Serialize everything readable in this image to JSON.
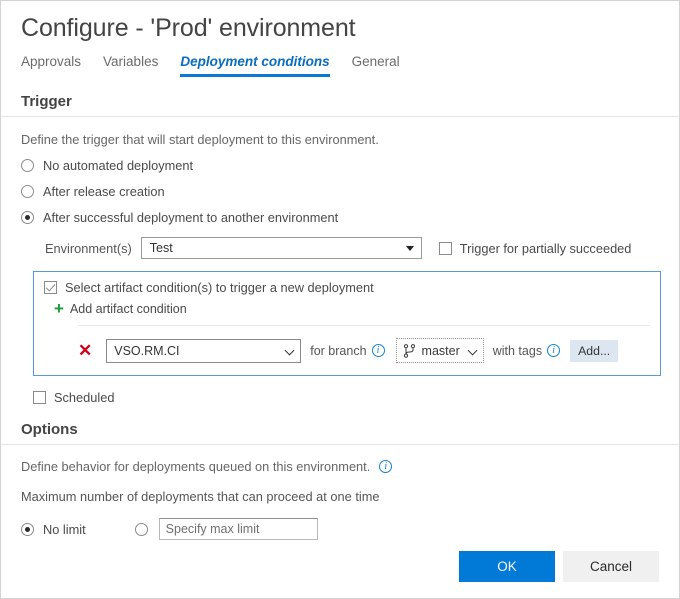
{
  "window": {
    "title": "Configure - 'Prod' environment"
  },
  "tabs": [
    {
      "label": "Approvals",
      "active": false
    },
    {
      "label": "Variables",
      "active": false
    },
    {
      "label": "Deployment conditions",
      "active": true
    },
    {
      "label": "General",
      "active": false
    }
  ],
  "trigger": {
    "heading": "Trigger",
    "description": "Define the trigger that will start deployment to this environment.",
    "options": [
      {
        "label": "No automated deployment",
        "selected": false
      },
      {
        "label": "After release creation",
        "selected": false
      },
      {
        "label": "After successful deployment to another environment",
        "selected": true
      }
    ],
    "environment": {
      "label": "Environment(s)",
      "value": "Test",
      "caret_icon": "caret-down-icon"
    },
    "partially_succeeded": {
      "label": "Trigger for partially succeeded",
      "checked": false
    },
    "artifact_conditions": {
      "checkbox_label": "Select artifact condition(s) to trigger a new deployment",
      "checked": true,
      "add_label": "Add artifact condition",
      "add_icon": "plus-icon",
      "rows": [
        {
          "remove_icon": "remove-x-icon",
          "artifact": "VSO.RM.CI",
          "for_branch_label": "for branch",
          "for_branch_info_icon": "info-icon",
          "branch_icon": "git-branch-icon",
          "branch": "master",
          "branch_caret_icon": "chevron-down-icon",
          "with_tags_label": "with tags",
          "with_tags_info_icon": "info-icon",
          "add_tags_label": "Add..."
        }
      ]
    },
    "scheduled": {
      "label": "Scheduled",
      "checked": false
    }
  },
  "options": {
    "heading": "Options",
    "description": "Define behavior for deployments queued on this environment.",
    "description_info_icon": "info-icon",
    "max_label": "Maximum number of deployments that can proceed at one time",
    "no_limit": {
      "label": "No limit",
      "selected": true
    },
    "specify": {
      "selected": false,
      "placeholder": "Specify max limit",
      "value": ""
    }
  },
  "footer": {
    "ok_label": "OK",
    "cancel_label": "Cancel"
  },
  "colors": {
    "accent": "#017ad7",
    "tab_active": "#0a6cbe",
    "panel_border": "#5b9bd5",
    "plus_green": "#1d9b39",
    "remove_red": "#d0021b",
    "add_button_bg": "#dce6f1",
    "cancel_bg": "#f0f0f0"
  }
}
